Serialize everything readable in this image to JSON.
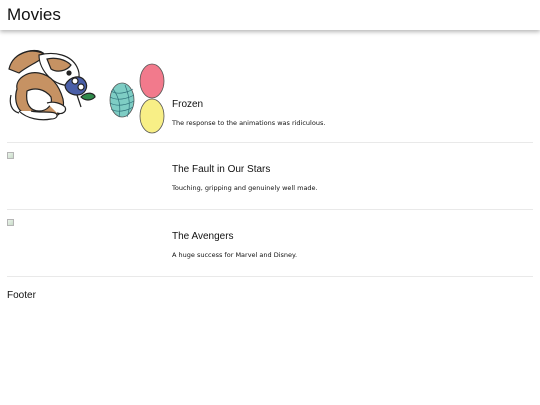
{
  "header": {
    "title": "Movies"
  },
  "movies": [
    {
      "title": "Frozen",
      "description": "The response to the animations was ridiculous.",
      "image": "bunny-and-easter-eggs-illustration"
    },
    {
      "title": "The Fault in Our Stars",
      "description": "Touching, gripping and genuinely well made.",
      "image": "broken-image-icon"
    },
    {
      "title": "The Avengers",
      "description": "A huge success for Marvel and Disney.",
      "image": "broken-image-icon"
    }
  ],
  "footer": {
    "text": "Footer"
  },
  "colors": {
    "divider": "#e9e9e9",
    "egg_pink": "#f27a8c",
    "egg_teal": "#7ecdc4",
    "egg_yellow": "#f8ef86",
    "bunny_brown": "#c69263"
  }
}
